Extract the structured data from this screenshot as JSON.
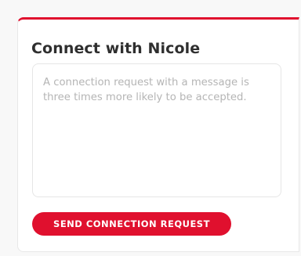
{
  "connect": {
    "title": "Connect with Nicole",
    "message_placeholder": "A connection request with a message is three times more likely to be accepted.",
    "message_value": "",
    "send_label": "SEND CONNECTION REQUEST"
  },
  "colors": {
    "accent": "#e0102e",
    "title_text": "#2f2f2f",
    "placeholder_text": "#b5b5b5"
  }
}
